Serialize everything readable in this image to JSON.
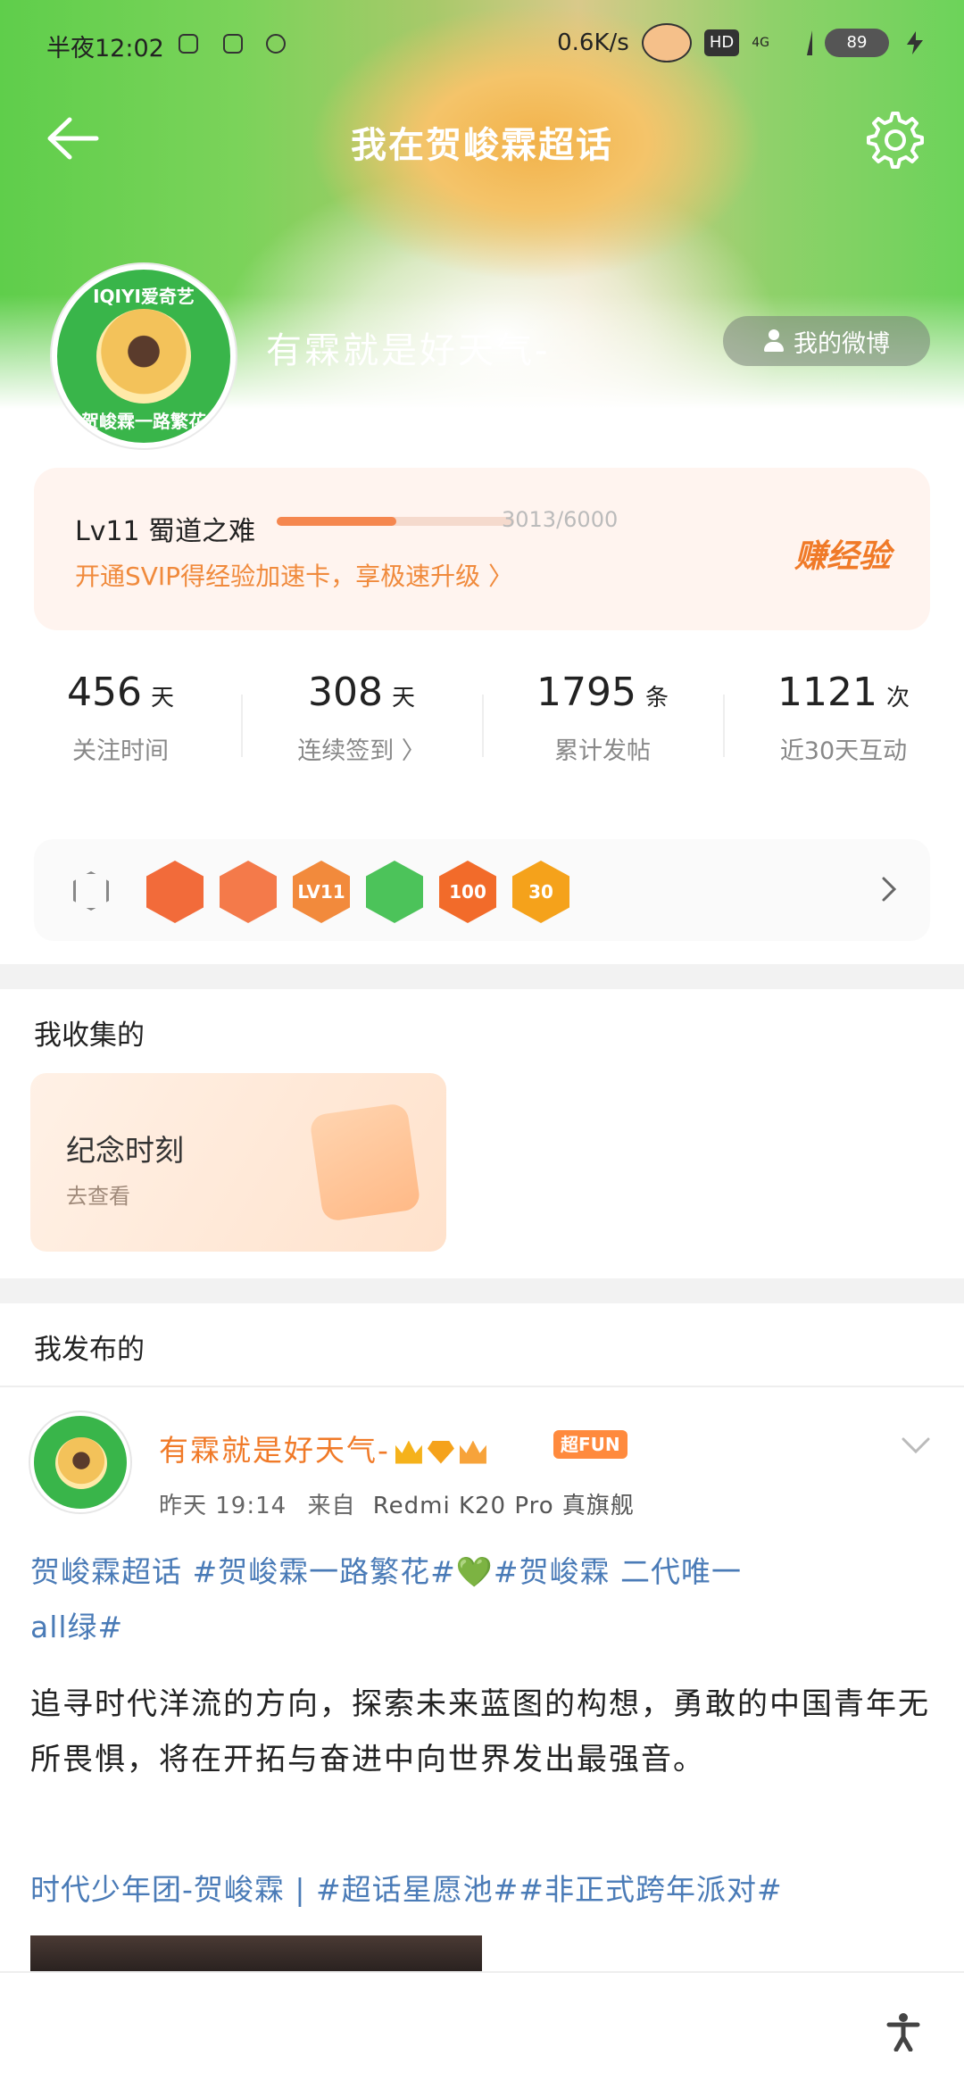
{
  "status_bar": {
    "time": "半夜12:02",
    "net_speed": "0.6K/s",
    "hd": "HD",
    "network": "4G",
    "battery": "89"
  },
  "nav": {
    "title": "我在贺峻霖超话"
  },
  "profile": {
    "avatar_ring_top": "IQIYI爱奇艺",
    "avatar_ring_bottom": "贺峻霖一路繁花",
    "name": "有霖就是好天气-",
    "weibo_button": "我的微博"
  },
  "level": {
    "label": "Lv11 蜀道之难",
    "progress_current": 3013,
    "progress_max": 6000,
    "progress_text": "3013/6000",
    "svip_tip": "开通SVIP得经验加速卡，享极速升级 〉",
    "earn_button": "赚经验"
  },
  "stats": [
    {
      "value": "456",
      "unit": "天",
      "label": "关注时间"
    },
    {
      "value": "308",
      "unit": "天",
      "label": "连续签到 〉"
    },
    {
      "value": "1795",
      "unit": "条",
      "label": "累计发帖"
    },
    {
      "value": "1121",
      "unit": "次",
      "label": "近30天互动"
    }
  ],
  "badges": [
    {
      "name": "tiger-badge",
      "color": "#f26b3a",
      "text": ""
    },
    {
      "name": "hands-badge",
      "color": "#f47a4a",
      "text": ""
    },
    {
      "name": "lv11-badge",
      "color": "#f28a3c",
      "text": "LV11"
    },
    {
      "name": "hand-green-badge",
      "color": "#4cc35a",
      "text": ""
    },
    {
      "name": "100-days-badge",
      "color": "#f26b2a",
      "text": "100"
    },
    {
      "name": "30-days-badge",
      "color": "#f5a21b",
      "text": "30"
    }
  ],
  "collections": {
    "title": "我收集的",
    "card_title": "纪念时刻",
    "card_sub": "去查看"
  },
  "posts": {
    "title": "我发布的",
    "post_name": "有霖就是好天气-",
    "fun_badge": "超FUN",
    "time": "昨天 19:14",
    "source_prefix": "来自",
    "source": "Redmi K20 Pro 真旗舰",
    "tags_line1": "贺峻霖超话 #贺峻霖一路繁花#💚#贺峻霖 二代唯一",
    "tags_line2": "all绿#",
    "body": "追寻时代洋流的方向，探索未来蓝图的构想，勇敢的中国青年无所畏惧，将在开拓与奋进中向世界发出最强音。",
    "tags_bottom": "时代少年团-贺峻霖    | #超话星愿池##非正式跨年派对#"
  },
  "colors": {
    "accent_orange": "#f07a28",
    "link_blue": "#4a7bb7",
    "hero_green": "#5fce4b"
  }
}
